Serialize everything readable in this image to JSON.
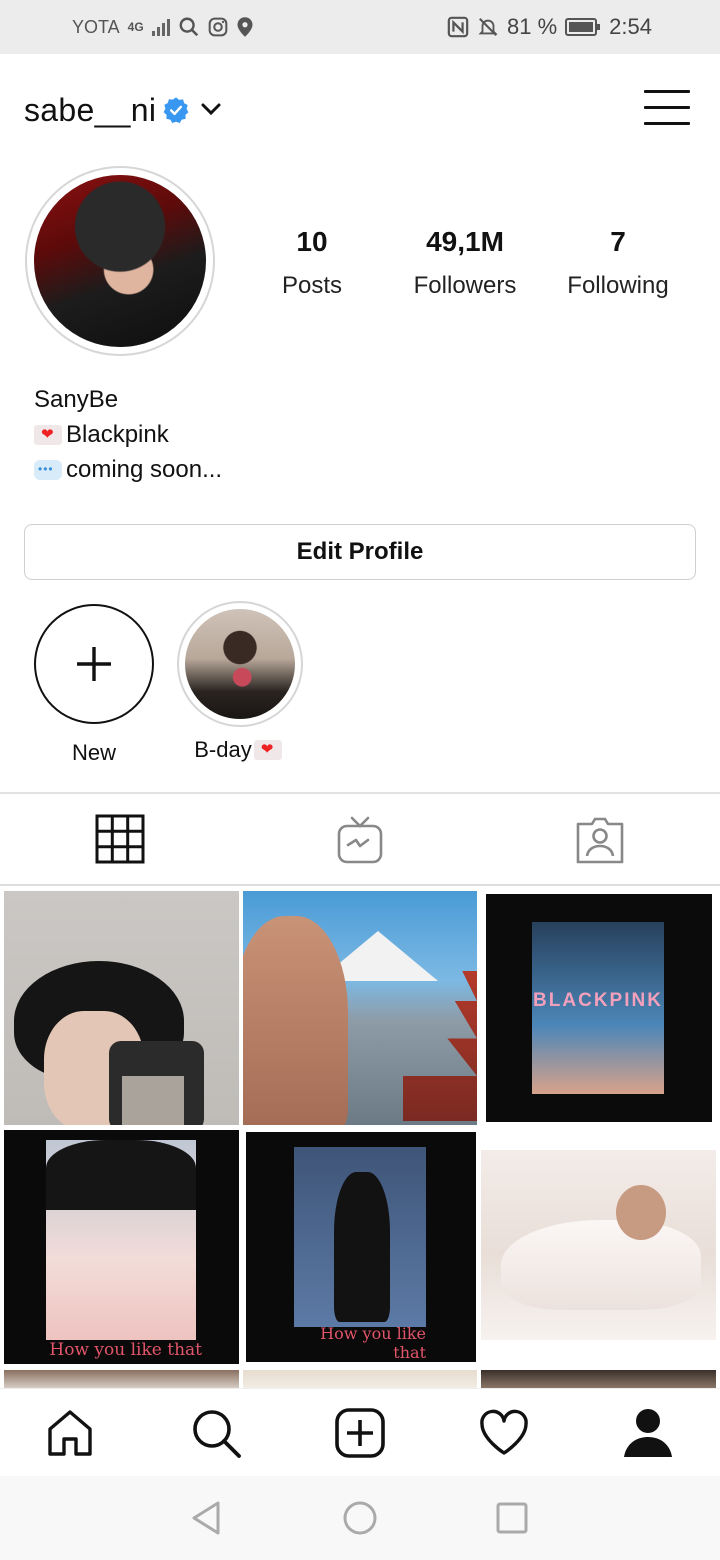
{
  "status_bar": {
    "carrier": "YOTA",
    "network": "4G",
    "battery": "81 %",
    "time": "2:54"
  },
  "profile": {
    "username": "sabe__ni",
    "verified": true,
    "display_name": "SanyBe",
    "bio": [
      {
        "icon": "heart-letter-emoji",
        "text": "Blackpink"
      },
      {
        "icon": "speech-bubble-emoji",
        "text": "coming soon..."
      }
    ],
    "edit_button": "Edit Profile"
  },
  "stats": [
    {
      "value": "10",
      "label": "Posts"
    },
    {
      "value": "49,1M",
      "label": "Followers"
    },
    {
      "value": "7",
      "label": "Following"
    }
  ],
  "highlights": [
    {
      "label": "New"
    },
    {
      "label": "B-day"
    }
  ],
  "tabs": [
    "grid-icon",
    "igtv-icon",
    "tagged-icon"
  ],
  "posts": [
    {
      "alt": "post-1"
    },
    {
      "alt": "post-2"
    },
    {
      "alt": "post-3",
      "caption": "BLACKPINK"
    },
    {
      "alt": "post-4",
      "caption": "How you like that"
    },
    {
      "alt": "post-5",
      "caption": "How you like that"
    },
    {
      "alt": "post-6"
    }
  ],
  "bottom_nav": [
    "home-icon",
    "search-icon",
    "new-post-icon",
    "activity-icon",
    "profile-icon"
  ],
  "colors": {
    "verified_badge": "#3897f0",
    "border": "#dbdbdb",
    "text": "#111111"
  }
}
